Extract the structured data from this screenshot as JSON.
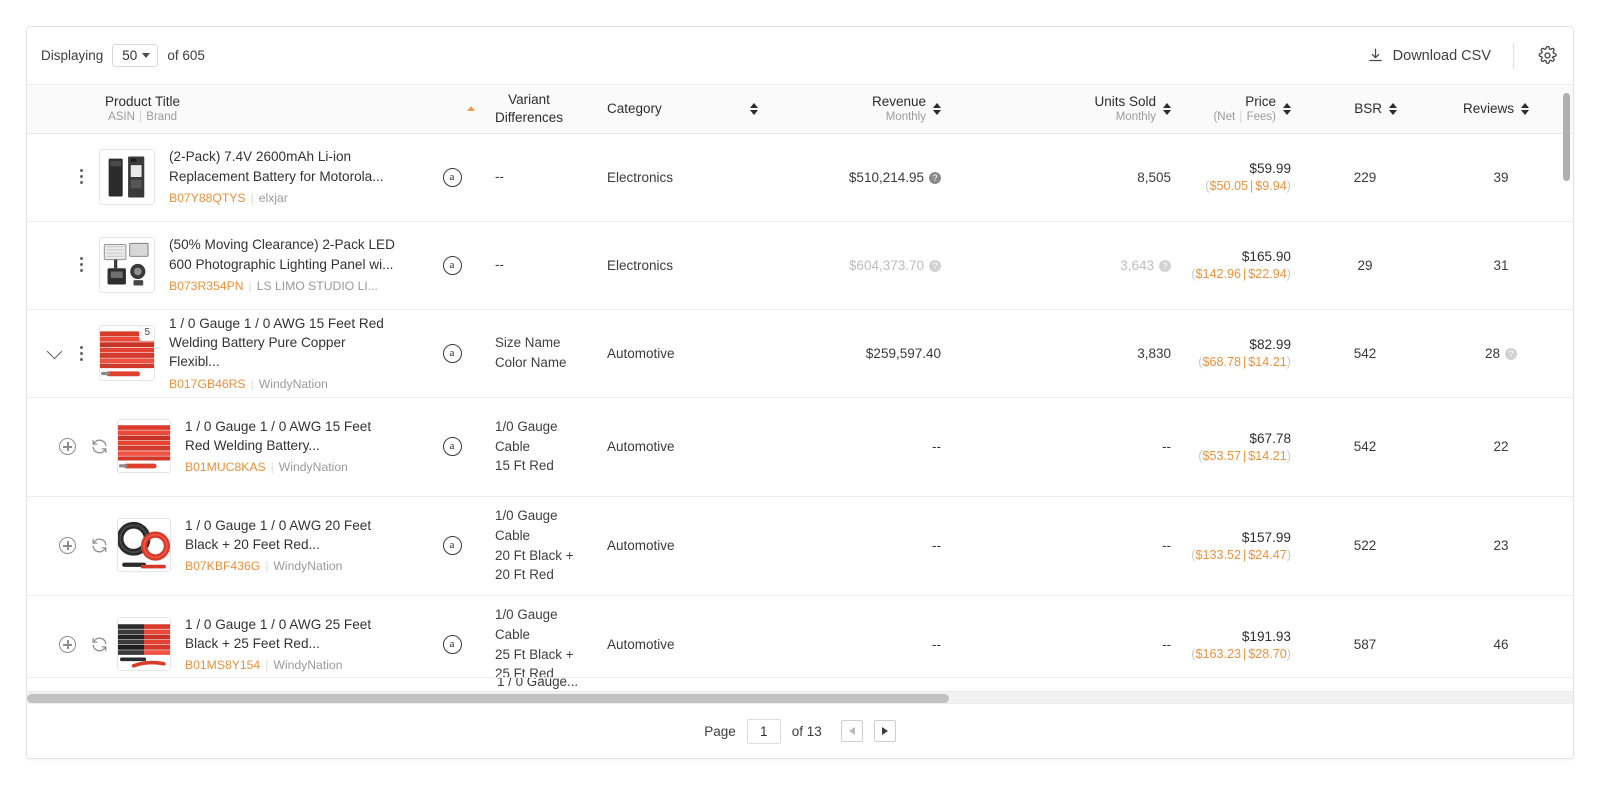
{
  "toolbar": {
    "displaying_label": "Displaying",
    "page_size": "50",
    "of_total": "of 605",
    "download_label": "Download CSV",
    "download_icon": "download-icon",
    "gear_icon": "gear-icon"
  },
  "columns": [
    {
      "key": "product",
      "main": "Product Title",
      "sub_a": "ASIN",
      "sub_b": "Brand",
      "sort": "asc"
    },
    {
      "key": "variant",
      "main": "Variant",
      "main2": "Differences",
      "sort": "none"
    },
    {
      "key": "category",
      "main": "Category",
      "sort": "both"
    },
    {
      "key": "revenue",
      "main": "Revenue",
      "sub": "Monthly",
      "sort": "both"
    },
    {
      "key": "units",
      "main": "Units Sold",
      "sub": "Monthly",
      "sort": "both"
    },
    {
      "key": "price",
      "main": "Price",
      "sub_a": "(Net",
      "sub_b": "Fees)",
      "sort": "both"
    },
    {
      "key": "bsr",
      "main": "BSR",
      "sort": "both"
    },
    {
      "key": "reviews",
      "main": "Reviews",
      "sort": "both"
    }
  ],
  "rows": [
    {
      "type": "main",
      "expandable": false,
      "variant_count": null,
      "title": "(2-Pack) 7.4V 2600mAh Li-ion Replacement Battery for Motorola...",
      "asin": "B07Y88QTYS",
      "brand": "elxjar",
      "amazon_icon": "amazon-icon",
      "variant_diff": [
        "--"
      ],
      "category": "Electronics",
      "revenue": "$510,214.95",
      "revenue_info": true,
      "revenue_muted": false,
      "units": "8,505",
      "units_info": false,
      "units_muted": false,
      "price": "$59.99",
      "price_net": "$50.05",
      "price_fees": "$9.94",
      "bsr": "229",
      "reviews": "39",
      "reviews_info": false,
      "art": "battery"
    },
    {
      "type": "main",
      "expandable": false,
      "variant_count": null,
      "title": "(50% Moving Clearance) 2-Pack LED 600 Photographic Lighting Panel wi...",
      "asin": "B073R354PN",
      "brand": "LS LIMO STUDIO LI...",
      "amazon_icon": "amazon-icon",
      "variant_diff": [
        "--"
      ],
      "category": "Electronics",
      "revenue": "$604,373.70",
      "revenue_info": true,
      "revenue_muted": true,
      "units": "3,643",
      "units_info": true,
      "units_muted": true,
      "price": "$165.90",
      "price_net": "$142.96",
      "price_fees": "$22.94",
      "bsr": "29",
      "reviews": "31",
      "reviews_info": false,
      "art": "lightpanel"
    },
    {
      "type": "main",
      "expandable": true,
      "variant_count": "5",
      "title": "1 / 0 Gauge 1 / 0 AWG 15 Feet Red Welding Battery Pure Copper Flexibl...",
      "asin": "B017GB46RS",
      "brand": "WindyNation",
      "amazon_icon": "amazon-icon",
      "variant_diff": [
        "Size Name",
        "Color Name"
      ],
      "category": "Automotive",
      "revenue": "$259,597.40",
      "revenue_info": false,
      "revenue_muted": false,
      "units": "3,830",
      "units_info": false,
      "units_muted": false,
      "price": "$82.99",
      "price_net": "$68.78",
      "price_fees": "$14.21",
      "bsr": "542",
      "reviews": "28",
      "reviews_info": true,
      "art": "redcable"
    },
    {
      "type": "sub",
      "title": "1 / 0 Gauge 1 / 0 AWG 15 Feet Red Welding Battery...",
      "asin": "B01MUC8KAS",
      "brand": "WindyNation",
      "amazon_icon": "amazon-icon",
      "variant_diff": [
        "1/0 Gauge",
        "Cable",
        "15 Ft Red"
      ],
      "category": "Automotive",
      "revenue": "--",
      "revenue_info": false,
      "revenue_muted": false,
      "units": "--",
      "units_info": false,
      "units_muted": false,
      "price": "$67.78",
      "price_net": "$53.57",
      "price_fees": "$14.21",
      "bsr": "542",
      "reviews": "22",
      "reviews_info": false,
      "art": "redcable"
    },
    {
      "type": "sub",
      "title": "1 / 0 Gauge 1 / 0 AWG 20 Feet Black + 20 Feet Red...",
      "asin": "B07KBF436G",
      "brand": "WindyNation",
      "amazon_icon": "amazon-icon",
      "variant_diff": [
        "1/0 Gauge",
        "Cable",
        "20 Ft Black +",
        "20 Ft Red"
      ],
      "category": "Automotive",
      "revenue": "--",
      "revenue_info": false,
      "revenue_muted": false,
      "units": "--",
      "units_info": false,
      "units_muted": false,
      "price": "$157.99",
      "price_net": "$133.52",
      "price_fees": "$24.47",
      "bsr": "522",
      "reviews": "23",
      "reviews_info": false,
      "art": "coilpair"
    },
    {
      "type": "sub",
      "title": "1 / 0 Gauge 1 / 0 AWG 25 Feet Black + 25 Feet Red...",
      "asin": "B01MS8Y154",
      "brand": "WindyNation",
      "amazon_icon": "amazon-icon",
      "variant_diff": [
        "1/0 Gauge",
        "Cable",
        "25 Ft Black +",
        "25 Ft Red"
      ],
      "category": "Automotive",
      "revenue": "--",
      "revenue_info": false,
      "revenue_muted": false,
      "units": "--",
      "units_info": false,
      "units_muted": false,
      "price": "$191.93",
      "price_net": "$163.23",
      "price_fees": "$28.70",
      "bsr": "587",
      "reviews": "46",
      "reviews_info": false,
      "art": "blackred"
    }
  ],
  "peek_text": "1 / 0 Gauge...",
  "footer": {
    "page_label": "Page",
    "page_value": "1",
    "of_pages": "of 13",
    "prev_icon": "chevron-left-icon",
    "next_icon": "chevron-right-icon"
  },
  "colors": {
    "accent_orange": "#e8913c",
    "sort_active": "#f0a04b",
    "text": "#3a3a3a",
    "muted": "#bdbdbd",
    "header_bg": "#fafafa"
  }
}
